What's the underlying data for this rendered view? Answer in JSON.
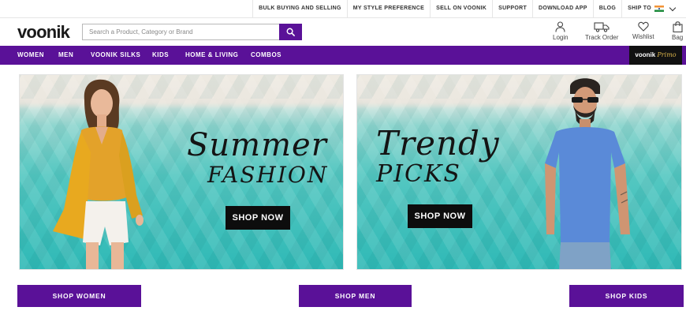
{
  "topbar": {
    "links": [
      "BULK BUYING AND SELLING",
      "MY STYLE PREFERENCE",
      "SELL ON VOONIK",
      "SUPPORT",
      "DOWNLOAD APP",
      "BLOG"
    ],
    "ship_to": "SHIP TO"
  },
  "header": {
    "logo": "voonik",
    "search_placeholder": "Search a Product, Category or Brand",
    "login": "Login",
    "track_order": "Track Order",
    "wishlist": "Wishlist",
    "bag": "Bag"
  },
  "nav": {
    "items": [
      "WOMEN",
      "MEN",
      "VOONIK SILKS",
      "KIDS",
      "HOME & LIVING",
      "COMBOS"
    ],
    "primo_brand": "voonik",
    "primo_word": "Primo"
  },
  "banners": [
    {
      "line1": "Summer",
      "line2": "FASHION",
      "cta": "SHOP NOW"
    },
    {
      "line1": "Trendy",
      "line2": "PICKS",
      "cta": "SHOP NOW"
    }
  ],
  "ctas": {
    "women": "SHOP WOMEN",
    "men": "SHOP MEN",
    "kids": "SHOP KIDS"
  },
  "colors": {
    "brand_purple": "#5a1198",
    "banner_teal": "#2fb9b6",
    "dark": "#0d0d0d"
  }
}
